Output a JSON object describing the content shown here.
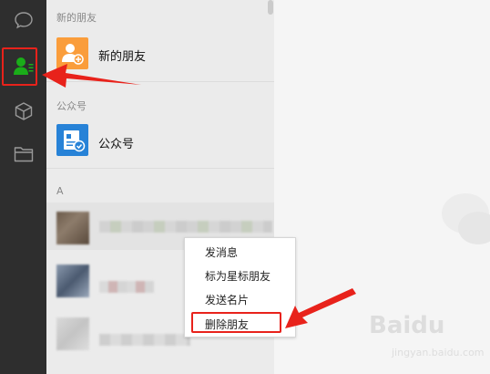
{
  "sidebar": {
    "items": [
      {
        "icon": "chat-icon"
      },
      {
        "icon": "contacts-icon",
        "active": true
      },
      {
        "icon": "cube-icon"
      },
      {
        "icon": "folder-icon"
      }
    ],
    "active_color": "#1aad19"
  },
  "contacts": {
    "section_new_friends": "新的朋友",
    "new_friends_item": "新的朋友",
    "section_official": "公众号",
    "official_item": "公众号",
    "section_letter": "A"
  },
  "context_menu": {
    "items": [
      "发消息",
      "标为星标朋友",
      "发送名片",
      "删除朋友"
    ]
  },
  "watermark": {
    "main": "Baidu",
    "sub": "jingyan.baidu.com"
  },
  "colors": {
    "highlight_red": "#e8221b",
    "new_friend_orange": "#fa9d3b",
    "official_blue": "#2782d7"
  }
}
